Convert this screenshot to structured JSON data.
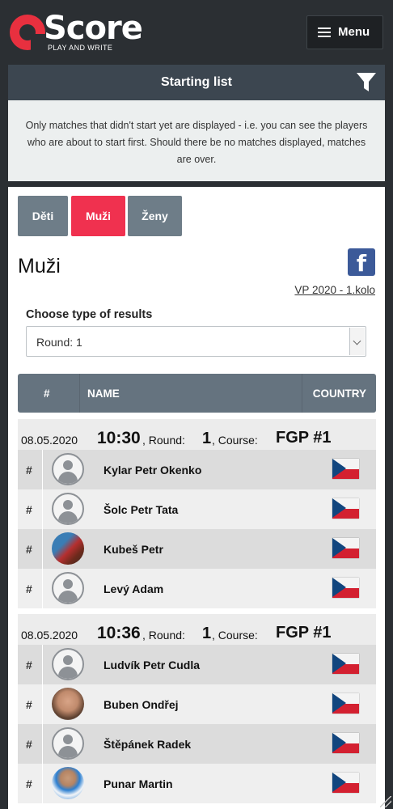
{
  "header": {
    "logo_text": "Score",
    "logo_tagline": "PLAY AND WRITE",
    "menu_label": "Menu"
  },
  "panel": {
    "title": "Starting list",
    "notice": "Only matches that didn't start yet are displayed - i.e. you can see the players who are about to start first. Should there be no matches displayed, matches are over."
  },
  "tabs": [
    "Děti",
    "Muži",
    "Ženy"
  ],
  "active_tab": "Muži",
  "section_title": "Muži",
  "competition_link": "VP 2020 - 1.kolo",
  "results_type": {
    "label": "Choose type of results",
    "selected": "Round: 1"
  },
  "table_header": {
    "num": "#",
    "name": "NAME",
    "country": "COUNTRY"
  },
  "matches": [
    {
      "date": "08.05.2020",
      "time": "10:30",
      "round_label": ", Round:",
      "round": "1",
      "course_label": ", Course:",
      "course": "FGP #1",
      "players": [
        {
          "num": "#",
          "name": "Kylar Petr Okenko",
          "avatar": "generic",
          "country": "CZ"
        },
        {
          "num": "#",
          "name": "Šolc Petr Tata",
          "avatar": "generic",
          "country": "CZ"
        },
        {
          "num": "#",
          "name": "Kubeš Petr",
          "avatar": "photo1",
          "country": "CZ"
        },
        {
          "num": "#",
          "name": "Levý Adam",
          "avatar": "generic",
          "country": "CZ"
        }
      ]
    },
    {
      "date": "08.05.2020",
      "time": "10:36",
      "round_label": ", Round:",
      "round": "1",
      "course_label": ", Course:",
      "course": "FGP #1",
      "players": [
        {
          "num": "#",
          "name": "Ludvík Petr Cudla",
          "avatar": "generic",
          "country": "CZ"
        },
        {
          "num": "#",
          "name": "Buben Ondřej",
          "avatar": "photo2",
          "country": "CZ"
        },
        {
          "num": "#",
          "name": "Štěpánek Radek",
          "avatar": "generic",
          "country": "CZ"
        },
        {
          "num": "#",
          "name": "Punar Martin",
          "avatar": "photo3",
          "country": "CZ"
        }
      ]
    }
  ],
  "colors": {
    "brand_red": "#e8303f",
    "active_tab": "#f0314f",
    "inactive_tab": "#6e7d88",
    "header_bg": "#2b2f33",
    "table_header": "#65737f"
  }
}
